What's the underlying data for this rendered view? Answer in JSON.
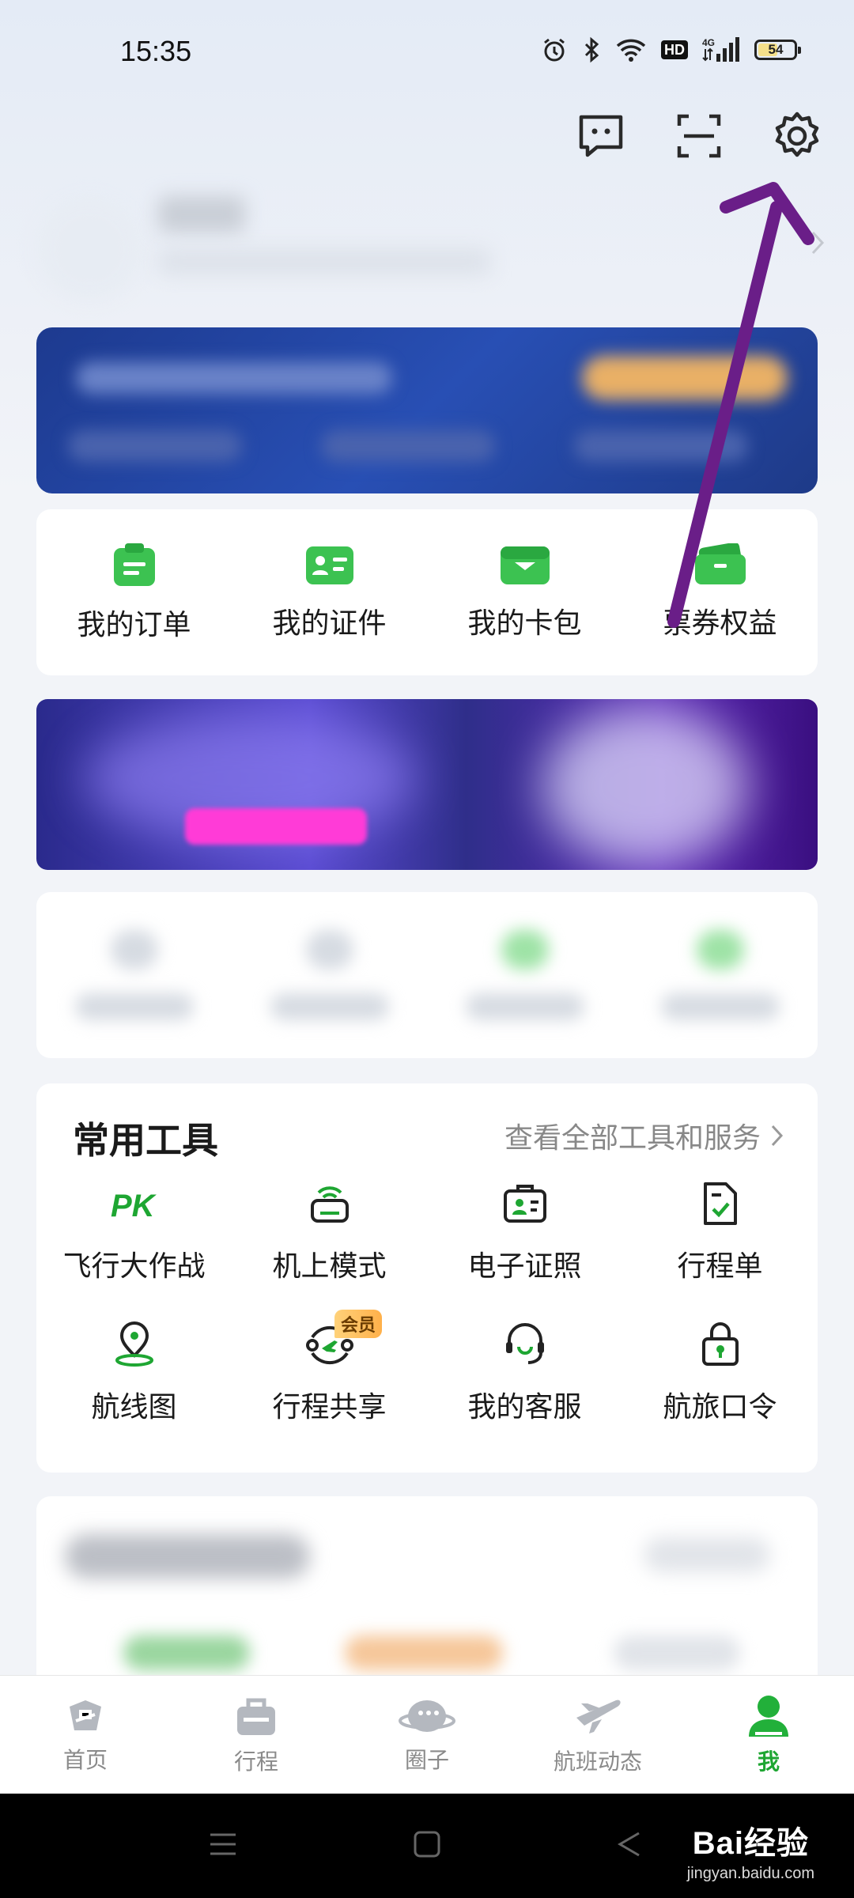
{
  "status_bar": {
    "time": "15:35",
    "hd": "HD",
    "network": "4G",
    "battery": "54",
    "battery_level": 0.54,
    "icons": [
      "alarm-icon",
      "bluetooth-icon",
      "wifi-icon",
      "hd-icon",
      "signal-icon",
      "battery-icon"
    ]
  },
  "header_icons": [
    "message-icon",
    "scan-icon",
    "settings-icon"
  ],
  "quick_links": [
    {
      "label": "我的订单",
      "icon": "order-icon"
    },
    {
      "label": "我的证件",
      "icon": "id-card-icon"
    },
    {
      "label": "我的卡包",
      "icon": "wallet-icon"
    },
    {
      "label": "票券权益",
      "icon": "ticket-icon"
    }
  ],
  "tools": {
    "title": "常用工具",
    "more_label": "查看全部工具和服务",
    "items": [
      {
        "label": "飞行大作战",
        "icon": "pk-icon",
        "icon_text": "PK"
      },
      {
        "label": "机上模式",
        "icon": "inflight-mode-icon"
      },
      {
        "label": "电子证照",
        "icon": "e-license-icon"
      },
      {
        "label": "行程单",
        "icon": "itinerary-icon"
      },
      {
        "label": "航线图",
        "icon": "route-map-icon"
      },
      {
        "label": "行程共享",
        "icon": "trip-share-icon",
        "badge": "会员"
      },
      {
        "label": "我的客服",
        "icon": "customer-service-icon"
      },
      {
        "label": "航旅口令",
        "icon": "travel-code-icon"
      }
    ]
  },
  "tab_bar": [
    {
      "label": "首页",
      "icon": "home-icon",
      "active": false
    },
    {
      "label": "行程",
      "icon": "trip-icon",
      "active": false
    },
    {
      "label": "圈子",
      "icon": "circle-icon",
      "active": false
    },
    {
      "label": "航班动态",
      "icon": "flight-status-icon",
      "active": false
    },
    {
      "label": "我",
      "icon": "me-icon",
      "active": true
    }
  ],
  "system_nav": [
    "menu-icon",
    "home-square-icon",
    "back-icon"
  ],
  "watermark": {
    "main": "Bai经验",
    "sub": "jingyan.baidu.com"
  },
  "colors": {
    "accent_green": "#1ea632",
    "icon_green": "#3cc251",
    "annotation_arrow": "#6a1e88"
  }
}
